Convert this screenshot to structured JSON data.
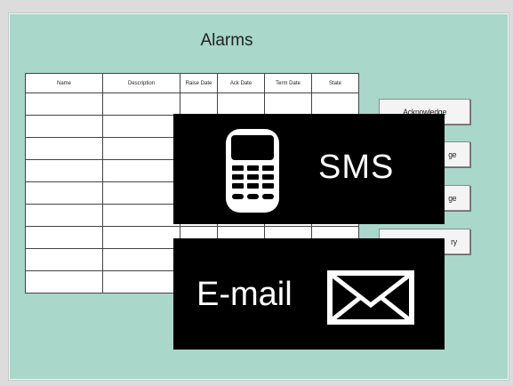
{
  "window": {
    "title": "Alarms"
  },
  "table": {
    "headers": [
      "Name",
      "Description",
      "Raise Date",
      "Ack Date",
      "Term Date",
      "State"
    ],
    "row_count": 9
  },
  "buttons": {
    "acknowledge": "Acknowledge",
    "button2_partial": "ge",
    "button3_partial": "ge",
    "history_partial": "ry"
  },
  "overlays": {
    "sms_label": "SMS",
    "email_label": "E-mail"
  },
  "colors": {
    "panel_bg": "#a9d7ca",
    "overlay_bg": "#000000"
  },
  "icons": {
    "sms": "mobile-phone-icon",
    "email": "envelope-icon"
  }
}
